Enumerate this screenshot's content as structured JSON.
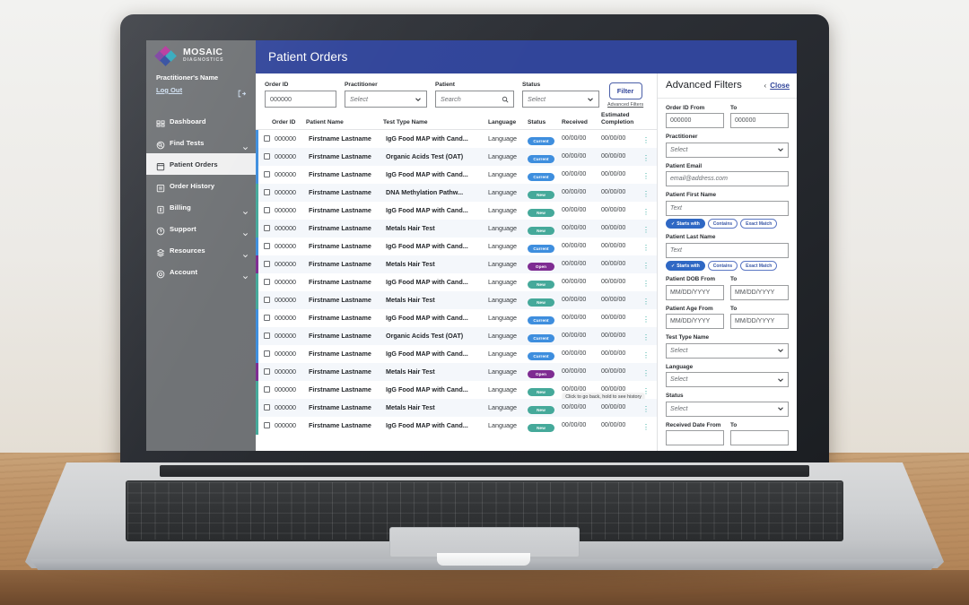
{
  "app": {
    "brand_main": "MOSAIC",
    "brand_sub": "DIAGNOSTICS",
    "page_title": "Patient Orders"
  },
  "colors": {
    "header_blue": "#31459A",
    "sidebar_gray": "#6E7174",
    "badge_current": "#3E8EDE",
    "badge_new": "#45A99A",
    "badge_open": "#7E2C92",
    "accent_link": "#31459A",
    "kebab_teal": "#2AA79B"
  },
  "sidebar": {
    "practitioner_name": "Practitioner's Name",
    "logout_label": "Log Out",
    "logout_icon": "logout-icon",
    "items": [
      {
        "label": "Dashboard",
        "icon": "dashboard-icon",
        "chevron": false,
        "active": false
      },
      {
        "label": "Find Tests",
        "icon": "search-circle-icon",
        "chevron": true,
        "active": false
      },
      {
        "label": "Patient Orders",
        "icon": "clipboard-icon",
        "chevron": false,
        "active": true
      },
      {
        "label": "Order History",
        "icon": "history-icon",
        "chevron": false,
        "active": false
      },
      {
        "label": "Billing",
        "icon": "billing-icon",
        "chevron": true,
        "active": false
      },
      {
        "label": "Support",
        "icon": "help-circle-icon",
        "chevron": true,
        "active": false
      },
      {
        "label": "Resources",
        "icon": "book-icon",
        "chevron": true,
        "active": false
      },
      {
        "label": "Account",
        "icon": "account-icon",
        "chevron": true,
        "active": false
      }
    ]
  },
  "filter_bar": {
    "fields": [
      {
        "label": "Order ID",
        "value": "000000",
        "placeholder": "000000",
        "type": "text",
        "italic": false
      },
      {
        "label": "Practitioner",
        "value": "Select",
        "placeholder": "Select",
        "type": "select",
        "italic": true
      },
      {
        "label": "Patient",
        "value": "Search",
        "placeholder": "Search",
        "type": "search",
        "italic": true
      },
      {
        "label": "Status",
        "value": "Select",
        "placeholder": "Select",
        "type": "select",
        "italic": true
      }
    ],
    "filter_button": "Filter",
    "advanced_link": "Advanced Filters"
  },
  "table": {
    "columns": [
      "Order ID",
      "Patient Name",
      "Test Type Name",
      "Language",
      "Status",
      "Received",
      "Estimated Completion"
    ],
    "columns_est_line1": "Estimated",
    "columns_est_line2": "Completion",
    "kebab_glyph": "⋮",
    "tooltip": "Click to go back, hold to see history",
    "rows": [
      {
        "order_id": "000000",
        "patient": "Firstname Lastname",
        "test": "IgG Food MAP with Cand...",
        "language": "Language",
        "status": "Current",
        "received": "00/00/00",
        "estimated": "00/00/00"
      },
      {
        "order_id": "000000",
        "patient": "Firstname Lastname",
        "test": "Organic Acids Test (OAT)",
        "language": "Language",
        "status": "Current",
        "received": "00/00/00",
        "estimated": "00/00/00"
      },
      {
        "order_id": "000000",
        "patient": "Firstname Lastname",
        "test": "IgG Food MAP with Cand...",
        "language": "Language",
        "status": "Current",
        "received": "00/00/00",
        "estimated": "00/00/00"
      },
      {
        "order_id": "000000",
        "patient": "Firstname Lastname",
        "test": "DNA Methylation Pathw...",
        "language": "Language",
        "status": "New",
        "received": "00/00/00",
        "estimated": "00/00/00"
      },
      {
        "order_id": "000000",
        "patient": "Firstname Lastname",
        "test": "IgG Food MAP with Cand...",
        "language": "Language",
        "status": "New",
        "received": "00/00/00",
        "estimated": "00/00/00"
      },
      {
        "order_id": "000000",
        "patient": "Firstname Lastname",
        "test": "Metals Hair Test",
        "language": "Language",
        "status": "New",
        "received": "00/00/00",
        "estimated": "00/00/00"
      },
      {
        "order_id": "000000",
        "patient": "Firstname Lastname",
        "test": "IgG Food MAP with Cand...",
        "language": "Language",
        "status": "Current",
        "received": "00/00/00",
        "estimated": "00/00/00"
      },
      {
        "order_id": "000000",
        "patient": "Firstname Lastname",
        "test": "Metals Hair Test",
        "language": "Language",
        "status": "Open",
        "received": "00/00/00",
        "estimated": "00/00/00"
      },
      {
        "order_id": "000000",
        "patient": "Firstname Lastname",
        "test": "IgG Food MAP with Cand...",
        "language": "Language",
        "status": "New",
        "received": "00/00/00",
        "estimated": "00/00/00"
      },
      {
        "order_id": "000000",
        "patient": "Firstname Lastname",
        "test": "Metals Hair Test",
        "language": "Language",
        "status": "New",
        "received": "00/00/00",
        "estimated": "00/00/00"
      },
      {
        "order_id": "000000",
        "patient": "Firstname Lastname",
        "test": "IgG Food MAP with Cand...",
        "language": "Language",
        "status": "Current",
        "received": "00/00/00",
        "estimated": "00/00/00"
      },
      {
        "order_id": "000000",
        "patient": "Firstname Lastname",
        "test": "Organic Acids Test (OAT)",
        "language": "Language",
        "status": "Current",
        "received": "00/00/00",
        "estimated": "00/00/00"
      },
      {
        "order_id": "000000",
        "patient": "Firstname Lastname",
        "test": "IgG Food MAP with Cand...",
        "language": "Language",
        "status": "Current",
        "received": "00/00/00",
        "estimated": "00/00/00"
      },
      {
        "order_id": "000000",
        "patient": "Firstname Lastname",
        "test": "Metals Hair Test",
        "language": "Language",
        "status": "Open",
        "received": "00/00/00",
        "estimated": "00/00/00"
      },
      {
        "order_id": "000000",
        "patient": "Firstname Lastname",
        "test": "IgG Food MAP with Cand...",
        "language": "Language",
        "status": "New",
        "received": "00/00/00",
        "estimated": "00/00/00"
      },
      {
        "order_id": "000000",
        "patient": "Firstname Lastname",
        "test": "Metals Hair Test",
        "language": "Language",
        "status": "New",
        "received": "00/00/00",
        "estimated": "00/00/00"
      },
      {
        "order_id": "000000",
        "patient": "Firstname Lastname",
        "test": "IgG Food MAP with Cand...",
        "language": "Language",
        "status": "New",
        "received": "00/00/00",
        "estimated": "00/00/00"
      }
    ]
  },
  "panel": {
    "title": "Advanced Filters",
    "chevron": "‹",
    "close_label": "Close",
    "order_id_from_label": "Order ID From",
    "order_id_to_label": "To",
    "order_id_from_value": "000000",
    "order_id_to_value": "000000",
    "practitioner_label": "Practitioner",
    "practitioner_value": "Select",
    "patient_email_label": "Patient Email",
    "patient_email_placeholder": "email@address.com",
    "patient_first_label": "Patient First Name",
    "patient_first_placeholder": "Text",
    "patient_last_label": "Patient Last Name",
    "patient_last_placeholder": "Text",
    "match_chips": [
      "Starts with",
      "Contains",
      "Exact Match"
    ],
    "match_active": "Starts with",
    "check_glyph": "✓",
    "dob_from_label": "Patient DOB From",
    "dob_to_label": "To",
    "dob_placeholder": "MM/DD/YYYY",
    "age_from_label": "Patient Age From",
    "age_to_label": "To",
    "age_placeholder": "MM/DD/YYYY",
    "test_type_label": "Test Type Name",
    "test_type_value": "Select",
    "language_label": "Language",
    "language_value": "Select",
    "status_label": "Status",
    "status_value": "Select",
    "received_from_label": "Received Date From",
    "received_to_label": "To"
  }
}
